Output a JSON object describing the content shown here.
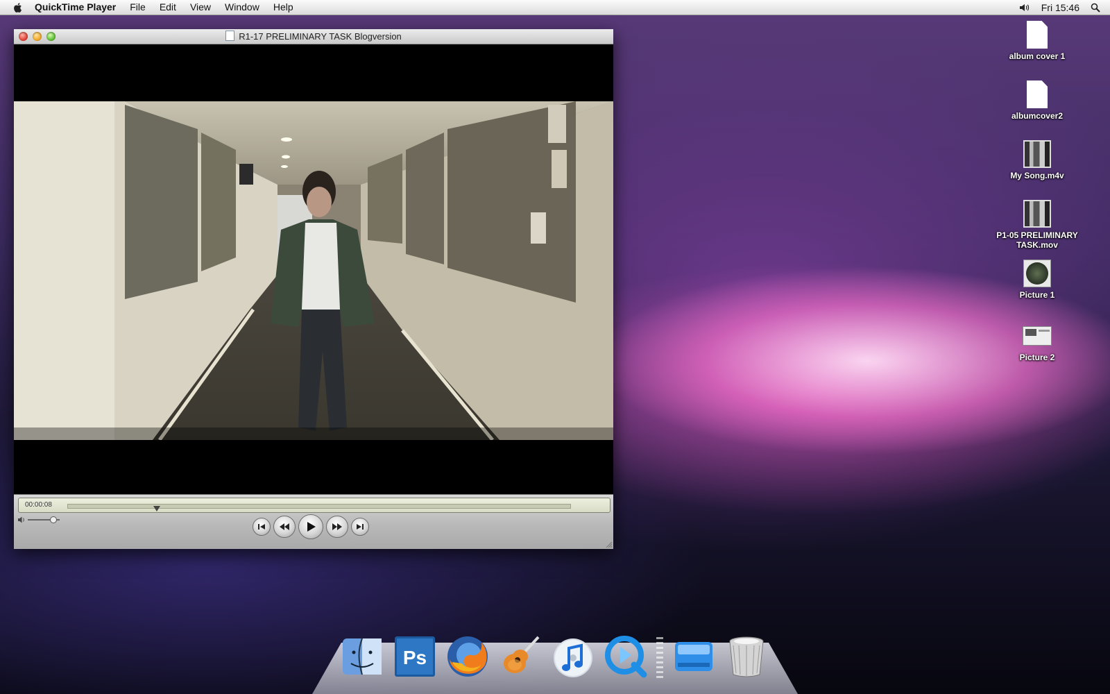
{
  "menubar": {
    "app_name": "QuickTime Player",
    "items": [
      "File",
      "Edit",
      "View",
      "Window",
      "Help"
    ],
    "clock": "Fri 15:46"
  },
  "window": {
    "title": "R1-17 PRELIMINARY TASK Blogversion",
    "timecode": "00:00:08",
    "playhead_fraction": 0.177,
    "volume_fraction": 0.78
  },
  "desktop_icons": [
    {
      "label": "album cover 1",
      "icon": "document-icon"
    },
    {
      "label": "albumcover2",
      "icon": "document-icon"
    },
    {
      "label": "My Song.m4v",
      "icon": "movie-icon"
    },
    {
      "label": "P1-05 PRELIMINARY TASK.mov",
      "icon": "movie-icon"
    },
    {
      "label": "Picture 1",
      "icon": "image-icon"
    },
    {
      "label": "Picture 2",
      "icon": "screenshot-icon"
    }
  ],
  "dock": [
    "finder-icon",
    "photoshop-icon",
    "firefox-icon",
    "garageband-icon",
    "itunes-icon",
    "quicktime-icon",
    "drive-icon",
    "trash-icon"
  ],
  "dock_labels": {
    "photoshop_text": "Ps"
  }
}
